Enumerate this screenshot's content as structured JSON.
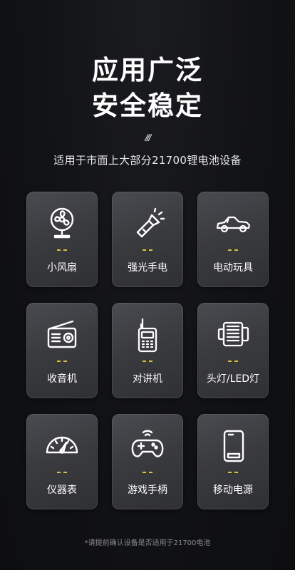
{
  "header": {
    "line1": "应用广泛",
    "line2": "安全稳定",
    "slashes": "///",
    "subtitle": "适用于市面上大部分21700锂电池设备"
  },
  "accent_color": "#d9c23c",
  "cards": [
    {
      "label": "小风扇",
      "icon": "fan-icon"
    },
    {
      "label": "强光手电",
      "icon": "flashlight-icon"
    },
    {
      "label": "电动玩具",
      "icon": "toy-car-icon"
    },
    {
      "label": "收音机",
      "icon": "radio-icon"
    },
    {
      "label": "对讲机",
      "icon": "walkie-talkie-icon"
    },
    {
      "label": "头灯/LED灯",
      "icon": "headlamp-icon"
    },
    {
      "label": "仪器表",
      "icon": "gauge-icon"
    },
    {
      "label": "游戏手柄",
      "icon": "gamepad-icon"
    },
    {
      "label": "移动电源",
      "icon": "power-bank-icon"
    }
  ],
  "footer": {
    "note": "*请提前确认设备是否适用于21700电池"
  }
}
